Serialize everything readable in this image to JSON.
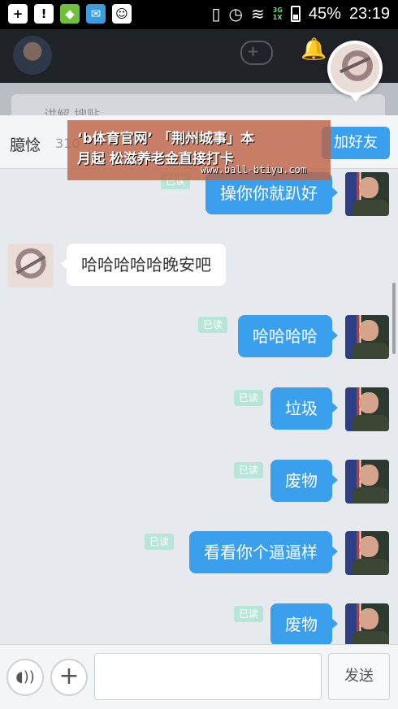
{
  "status_bar": {
    "icons": [
      "add-icon",
      "alert-icon",
      "shop-icon",
      "mail-icon",
      "android-icon"
    ],
    "right_icons": [
      "vibrate-icon",
      "alarm-icon",
      "wifi-icon"
    ],
    "network_top": "3G",
    "network_bottom": "1X",
    "battery": "45%",
    "time": "23:19"
  },
  "background": {
    "search_text": "讲解   搜贴"
  },
  "chat_header": {
    "peer_name": "臆惗",
    "peer_id": "310",
    "add_friend_label": "加好友"
  },
  "watermark": {
    "line1": "‘b体育官网’ 「荆州城事」本",
    "line2": "月起 松滋养老金直接打卡",
    "url": "www.ball-btiyu.com"
  },
  "messages": [
    {
      "from": "self",
      "text": "操你你就趴好",
      "read": "已读"
    },
    {
      "from": "peer",
      "text": "哈哈哈哈哈晚安吧"
    },
    {
      "from": "self",
      "text": "哈哈哈哈",
      "read": "已读"
    },
    {
      "from": "self",
      "text": "垃圾",
      "read": "已读"
    },
    {
      "from": "self",
      "text": "废物",
      "read": "已读"
    },
    {
      "from": "self",
      "text": "看看你个逼逼样",
      "read": "已读"
    },
    {
      "from": "self",
      "text": "废物",
      "read": "已读"
    }
  ],
  "input_bar": {
    "voice_icon": "voice-icon",
    "plus_icon": "plus-icon",
    "input_value": "",
    "send_label": "发送"
  }
}
